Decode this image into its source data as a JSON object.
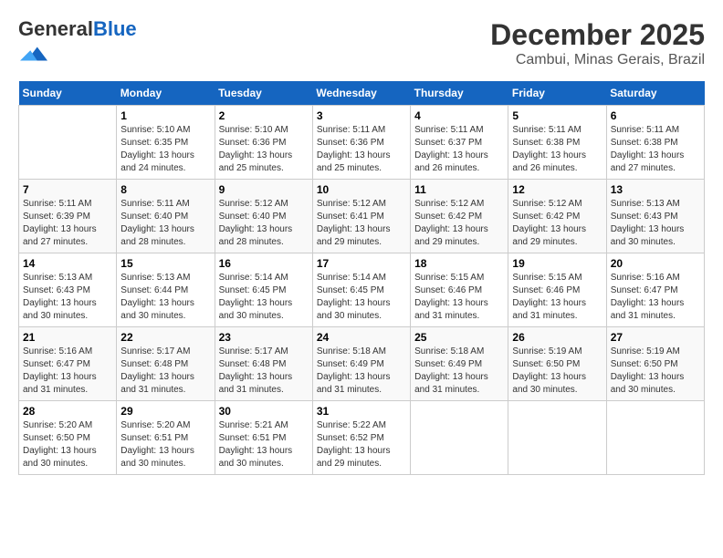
{
  "header": {
    "logo_general": "General",
    "logo_blue": "Blue",
    "main_title": "December 2025",
    "subtitle": "Cambui, Minas Gerais, Brazil"
  },
  "weekdays": [
    "Sunday",
    "Monday",
    "Tuesday",
    "Wednesday",
    "Thursday",
    "Friday",
    "Saturday"
  ],
  "weeks": [
    [
      {
        "day": "",
        "sunrise": "",
        "sunset": "",
        "daylight": ""
      },
      {
        "day": "1",
        "sunrise": "Sunrise: 5:10 AM",
        "sunset": "Sunset: 6:35 PM",
        "daylight": "Daylight: 13 hours and 24 minutes."
      },
      {
        "day": "2",
        "sunrise": "Sunrise: 5:10 AM",
        "sunset": "Sunset: 6:36 PM",
        "daylight": "Daylight: 13 hours and 25 minutes."
      },
      {
        "day": "3",
        "sunrise": "Sunrise: 5:11 AM",
        "sunset": "Sunset: 6:36 PM",
        "daylight": "Daylight: 13 hours and 25 minutes."
      },
      {
        "day": "4",
        "sunrise": "Sunrise: 5:11 AM",
        "sunset": "Sunset: 6:37 PM",
        "daylight": "Daylight: 13 hours and 26 minutes."
      },
      {
        "day": "5",
        "sunrise": "Sunrise: 5:11 AM",
        "sunset": "Sunset: 6:38 PM",
        "daylight": "Daylight: 13 hours and 26 minutes."
      },
      {
        "day": "6",
        "sunrise": "Sunrise: 5:11 AM",
        "sunset": "Sunset: 6:38 PM",
        "daylight": "Daylight: 13 hours and 27 minutes."
      }
    ],
    [
      {
        "day": "7",
        "sunrise": "Sunrise: 5:11 AM",
        "sunset": "Sunset: 6:39 PM",
        "daylight": "Daylight: 13 hours and 27 minutes."
      },
      {
        "day": "8",
        "sunrise": "Sunrise: 5:11 AM",
        "sunset": "Sunset: 6:40 PM",
        "daylight": "Daylight: 13 hours and 28 minutes."
      },
      {
        "day": "9",
        "sunrise": "Sunrise: 5:12 AM",
        "sunset": "Sunset: 6:40 PM",
        "daylight": "Daylight: 13 hours and 28 minutes."
      },
      {
        "day": "10",
        "sunrise": "Sunrise: 5:12 AM",
        "sunset": "Sunset: 6:41 PM",
        "daylight": "Daylight: 13 hours and 29 minutes."
      },
      {
        "day": "11",
        "sunrise": "Sunrise: 5:12 AM",
        "sunset": "Sunset: 6:42 PM",
        "daylight": "Daylight: 13 hours and 29 minutes."
      },
      {
        "day": "12",
        "sunrise": "Sunrise: 5:12 AM",
        "sunset": "Sunset: 6:42 PM",
        "daylight": "Daylight: 13 hours and 29 minutes."
      },
      {
        "day": "13",
        "sunrise": "Sunrise: 5:13 AM",
        "sunset": "Sunset: 6:43 PM",
        "daylight": "Daylight: 13 hours and 30 minutes."
      }
    ],
    [
      {
        "day": "14",
        "sunrise": "Sunrise: 5:13 AM",
        "sunset": "Sunset: 6:43 PM",
        "daylight": "Daylight: 13 hours and 30 minutes."
      },
      {
        "day": "15",
        "sunrise": "Sunrise: 5:13 AM",
        "sunset": "Sunset: 6:44 PM",
        "daylight": "Daylight: 13 hours and 30 minutes."
      },
      {
        "day": "16",
        "sunrise": "Sunrise: 5:14 AM",
        "sunset": "Sunset: 6:45 PM",
        "daylight": "Daylight: 13 hours and 30 minutes."
      },
      {
        "day": "17",
        "sunrise": "Sunrise: 5:14 AM",
        "sunset": "Sunset: 6:45 PM",
        "daylight": "Daylight: 13 hours and 30 minutes."
      },
      {
        "day": "18",
        "sunrise": "Sunrise: 5:15 AM",
        "sunset": "Sunset: 6:46 PM",
        "daylight": "Daylight: 13 hours and 31 minutes."
      },
      {
        "day": "19",
        "sunrise": "Sunrise: 5:15 AM",
        "sunset": "Sunset: 6:46 PM",
        "daylight": "Daylight: 13 hours and 31 minutes."
      },
      {
        "day": "20",
        "sunrise": "Sunrise: 5:16 AM",
        "sunset": "Sunset: 6:47 PM",
        "daylight": "Daylight: 13 hours and 31 minutes."
      }
    ],
    [
      {
        "day": "21",
        "sunrise": "Sunrise: 5:16 AM",
        "sunset": "Sunset: 6:47 PM",
        "daylight": "Daylight: 13 hours and 31 minutes."
      },
      {
        "day": "22",
        "sunrise": "Sunrise: 5:17 AM",
        "sunset": "Sunset: 6:48 PM",
        "daylight": "Daylight: 13 hours and 31 minutes."
      },
      {
        "day": "23",
        "sunrise": "Sunrise: 5:17 AM",
        "sunset": "Sunset: 6:48 PM",
        "daylight": "Daylight: 13 hours and 31 minutes."
      },
      {
        "day": "24",
        "sunrise": "Sunrise: 5:18 AM",
        "sunset": "Sunset: 6:49 PM",
        "daylight": "Daylight: 13 hours and 31 minutes."
      },
      {
        "day": "25",
        "sunrise": "Sunrise: 5:18 AM",
        "sunset": "Sunset: 6:49 PM",
        "daylight": "Daylight: 13 hours and 31 minutes."
      },
      {
        "day": "26",
        "sunrise": "Sunrise: 5:19 AM",
        "sunset": "Sunset: 6:50 PM",
        "daylight": "Daylight: 13 hours and 30 minutes."
      },
      {
        "day": "27",
        "sunrise": "Sunrise: 5:19 AM",
        "sunset": "Sunset: 6:50 PM",
        "daylight": "Daylight: 13 hours and 30 minutes."
      }
    ],
    [
      {
        "day": "28",
        "sunrise": "Sunrise: 5:20 AM",
        "sunset": "Sunset: 6:50 PM",
        "daylight": "Daylight: 13 hours and 30 minutes."
      },
      {
        "day": "29",
        "sunrise": "Sunrise: 5:20 AM",
        "sunset": "Sunset: 6:51 PM",
        "daylight": "Daylight: 13 hours and 30 minutes."
      },
      {
        "day": "30",
        "sunrise": "Sunrise: 5:21 AM",
        "sunset": "Sunset: 6:51 PM",
        "daylight": "Daylight: 13 hours and 30 minutes."
      },
      {
        "day": "31",
        "sunrise": "Sunrise: 5:22 AM",
        "sunset": "Sunset: 6:52 PM",
        "daylight": "Daylight: 13 hours and 29 minutes."
      },
      {
        "day": "",
        "sunrise": "",
        "sunset": "",
        "daylight": ""
      },
      {
        "day": "",
        "sunrise": "",
        "sunset": "",
        "daylight": ""
      },
      {
        "day": "",
        "sunrise": "",
        "sunset": "",
        "daylight": ""
      }
    ]
  ]
}
